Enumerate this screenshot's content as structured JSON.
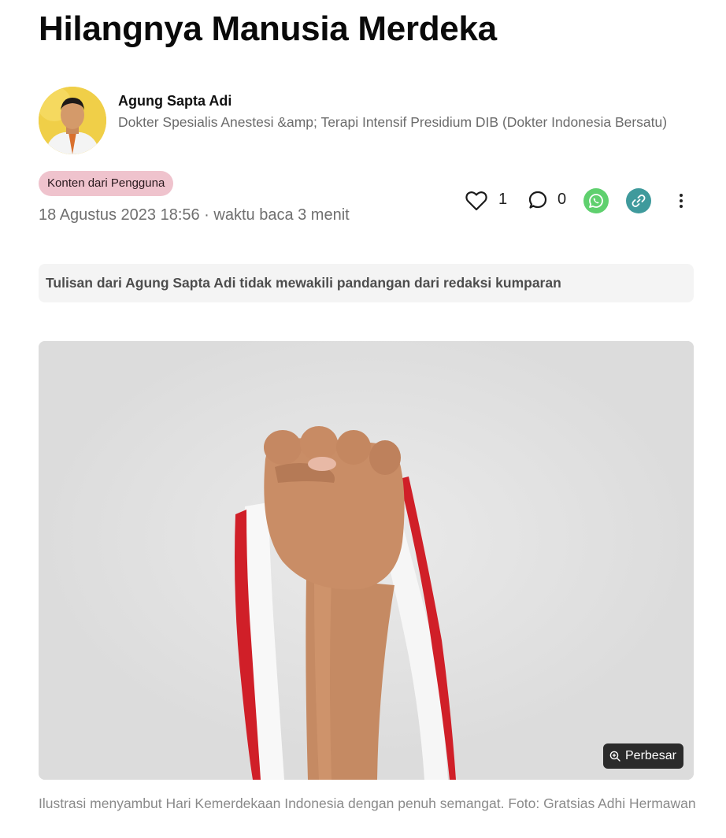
{
  "article": {
    "title": "Hilangnya Manusia Merdeka",
    "badge": "Konten dari Pengguna",
    "meta": "18 Agustus 2023 18:56 · waktu baca 3 menit",
    "disclaimer": "Tulisan dari Agung Sapta Adi tidak mewakili pandangan dari redaksi kumparan"
  },
  "author": {
    "name": "Agung Sapta Adi",
    "bio": "Dokter Spesialis Anestesi &amp; Terapi Intensif Presidium DIB (Dokter Indonesia Bersatu)"
  },
  "actions": {
    "like_count": "1",
    "comment_count": "0",
    "icons": [
      "heart-icon",
      "comment-icon",
      "whatsapp-icon",
      "link-icon",
      "more-vertical-icon"
    ]
  },
  "image": {
    "zoom_label": "Perbesar",
    "caption": "Ilustrasi menyambut Hari Kemerdekaan Indonesia dengan penuh semangat. Foto: Gratsias Adhi Hermawan"
  },
  "colors": {
    "badge_bg": "#efc3cd",
    "whatsapp": "#5fd06e",
    "link": "#3f9a9c",
    "ribbon_red": "#d01f28"
  }
}
